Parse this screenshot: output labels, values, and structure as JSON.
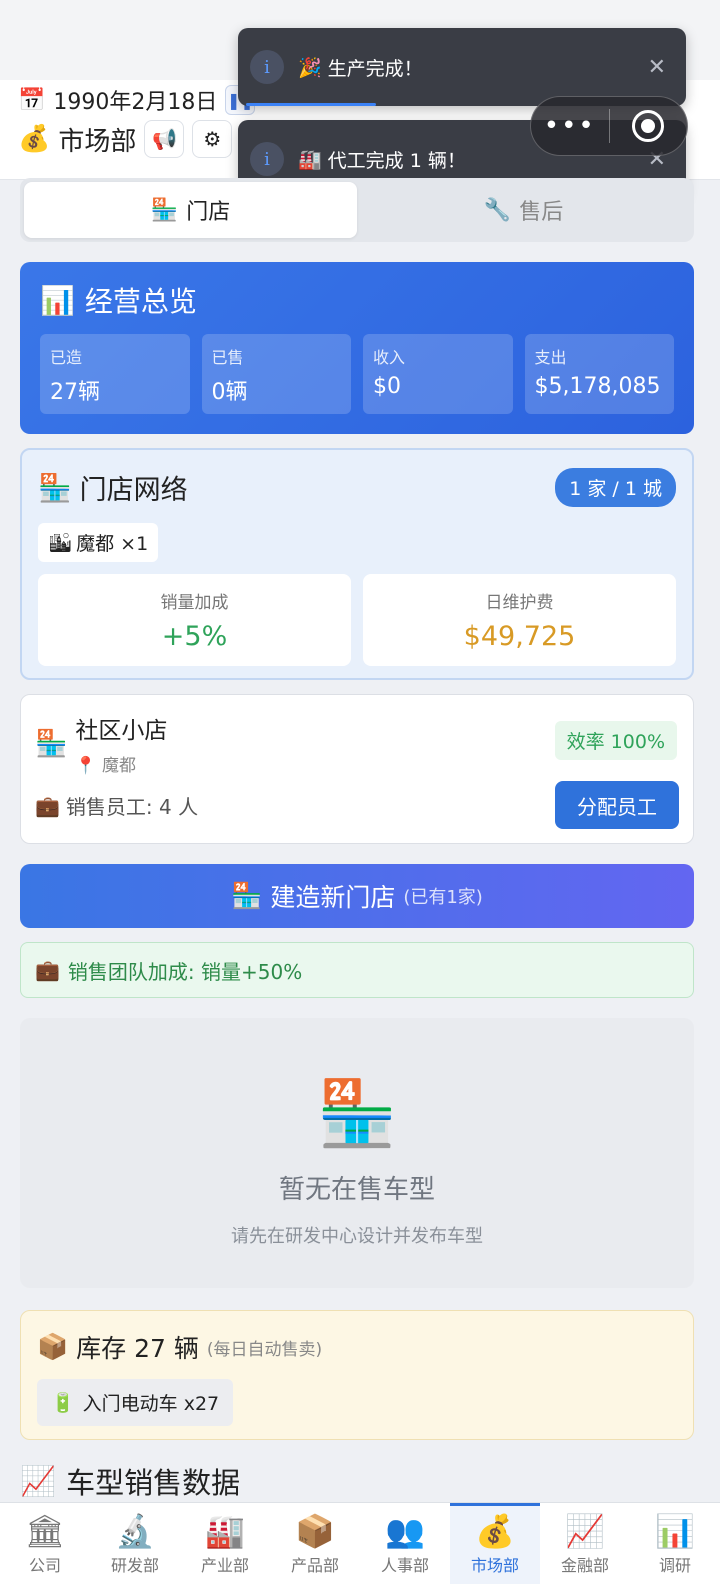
{
  "header": {
    "date": "1990年2月18日",
    "pause_icon": "pause-icon",
    "department": "市场部",
    "date_icon": "📅",
    "dept_icon": "💰"
  },
  "toasts": [
    {
      "icon": "🎉",
      "message": "生产完成！"
    },
    {
      "icon": "🏭",
      "message": "代工完成 1 辆！"
    }
  ],
  "tabs": [
    {
      "icon": "🏪",
      "label": "门店",
      "active": true
    },
    {
      "icon": "🔧",
      "label": "售后",
      "active": false
    }
  ],
  "overview": {
    "icon": "📊",
    "title": "经营总览",
    "stats": [
      {
        "label": "已造",
        "value": "27辆"
      },
      {
        "label": "已售",
        "value": "0辆"
      },
      {
        "label": "收入",
        "value": "$0"
      },
      {
        "label": "支出",
        "value": "$5,178,085"
      }
    ]
  },
  "network": {
    "icon": "🏪",
    "title": "门店网络",
    "badge": "1 家 / 1 城",
    "city_chip": "魔都 ×1",
    "sales_bonus_label": "销量加成",
    "sales_bonus_value": "+5%",
    "maintenance_label": "日维护费",
    "maintenance_value": "$49,725"
  },
  "shop": {
    "name": "社区小店",
    "location": "魔都",
    "efficiency": "效率 100%",
    "staff": "销售员工: 4 人",
    "assign_button": "分配员工"
  },
  "build": {
    "label": "建造新门店",
    "sub": "(已有1家)"
  },
  "bonus_text": "销售团队加成: 销量+50%",
  "empty": {
    "title": "暂无在售车型",
    "subtitle": "请先在研发中心设计并发布车型"
  },
  "stock": {
    "title": "库存 27 辆",
    "sub": "(每日自动售卖)",
    "item": "入门电动车 x27"
  },
  "sales_title": "车型销售数据",
  "nav": [
    {
      "icon": "🏛",
      "label": "公司"
    },
    {
      "icon": "🔬",
      "label": "研发部"
    },
    {
      "icon": "🏭",
      "label": "产业部"
    },
    {
      "icon": "📦",
      "label": "产品部"
    },
    {
      "icon": "👥",
      "label": "人事部"
    },
    {
      "icon": "💰",
      "label": "市场部",
      "active": true
    },
    {
      "icon": "📈",
      "label": "金融部"
    },
    {
      "icon": "📊",
      "label": "调研"
    }
  ]
}
